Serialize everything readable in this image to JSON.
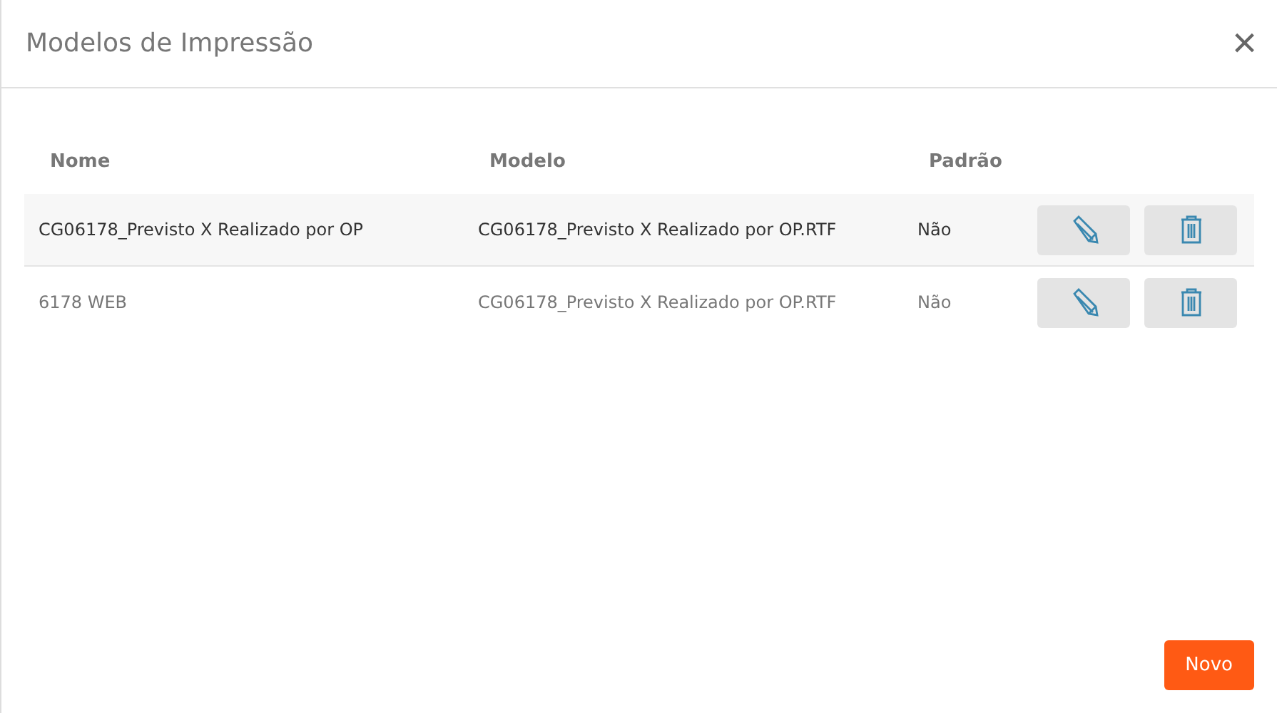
{
  "dialog": {
    "title": "Modelos de Impressão",
    "close": "×"
  },
  "table": {
    "columns": [
      "Nome",
      "Modelo",
      "Padrão"
    ],
    "rows": [
      {
        "name": "CG06178_Previsto X Realizado por OP",
        "model": "CG06178_Previsto X Realizado por OP.RTF",
        "default": "Não",
        "selected": true
      },
      {
        "name": "6178 WEB",
        "model": "CG06178_Previsto X Realizado por OP.RTF",
        "default": "Não",
        "selected": false
      }
    ]
  },
  "footer": {
    "new_button": "Novo"
  }
}
